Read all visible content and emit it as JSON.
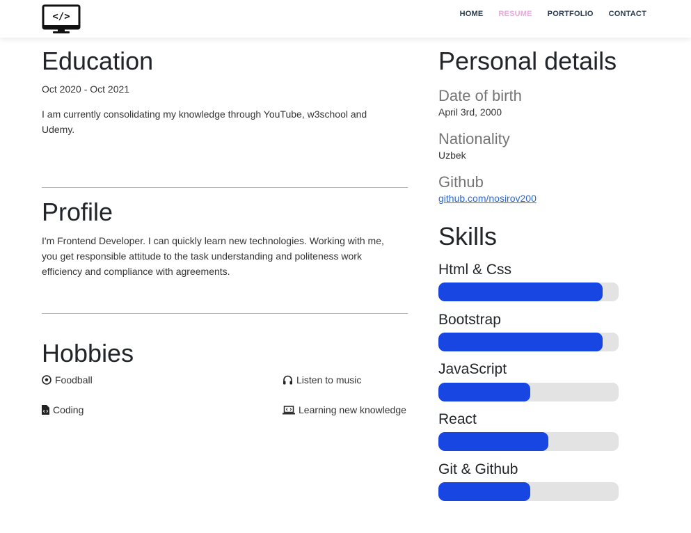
{
  "nav": {
    "items": [
      {
        "label": "HOME",
        "active": false
      },
      {
        "label": "RESUME",
        "active": true
      },
      {
        "label": "PORTFOLIO",
        "active": false
      },
      {
        "label": "CONTACT",
        "active": false
      }
    ]
  },
  "logo": {
    "icon": "monitor-code-icon",
    "text": "</>"
  },
  "education": {
    "title": "Education",
    "dates": "Oct 2020 - Oct 2021",
    "text": "I am currently consolidating my knowledge through YouTube, w3school and Udemy."
  },
  "profile": {
    "title": "Profile",
    "text": "I'm Frontend Developer. I can quickly learn new technologies. Working with me, you get responsible attitude to the task understanding and politeness work efficiency and compliance with agreements."
  },
  "hobbies": {
    "title": "Hobbies",
    "items": [
      {
        "label": "Foodball",
        "icon": "football-icon"
      },
      {
        "label": "Listen to music",
        "icon": "headphones-icon"
      },
      {
        "label": "Coding",
        "icon": "code-file-icon"
      },
      {
        "label": "Learning new knowledge",
        "icon": "laptop-code-icon"
      }
    ]
  },
  "personal": {
    "title": "Personal details",
    "birth_label": "Date of birth",
    "birth_value": "April 3rd, 2000",
    "nationality_label": "Nationality",
    "nationality_value": "Uzbek",
    "github_label": "Github",
    "github_value": "github.com/nosirov200"
  },
  "skills": {
    "title": "Skills",
    "items": [
      {
        "name": "Html & Css",
        "level": 0.91
      },
      {
        "name": "Bootstrap",
        "level": 0.91
      },
      {
        "name": "JavaScript",
        "level": 0.51
      },
      {
        "name": "React",
        "level": 0.61
      },
      {
        "name": "Git & Github",
        "level": 0.51
      }
    ]
  },
  "colors": {
    "accent_nav_active": "#e7a8dc",
    "skill_fill": "#1746e3",
    "skill_track": "#e3e3e3",
    "link": "#2969d6"
  }
}
